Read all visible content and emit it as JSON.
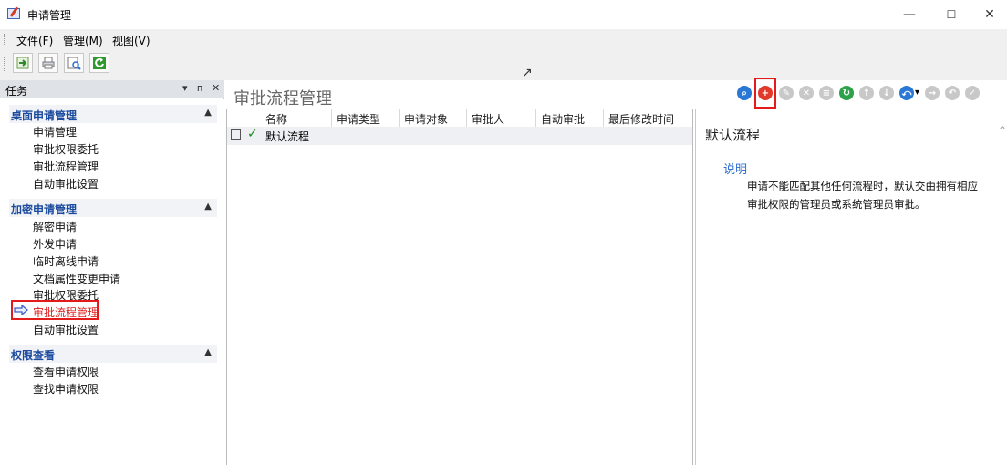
{
  "window": {
    "title": "申请管理",
    "minimize": "—",
    "maximize": "☐",
    "close": "✕"
  },
  "menu": {
    "items": [
      "文件(F)",
      "管理(M)",
      "视图(V)"
    ]
  },
  "tasks_panel": {
    "title": "任务",
    "controls": [
      "▾",
      "ᴨ",
      "✕"
    ],
    "groups": [
      {
        "title": "桌面申请管理",
        "items": [
          "申请管理",
          "审批权限委托",
          "审批流程管理",
          "自动审批设置"
        ]
      },
      {
        "title": "加密申请管理",
        "items": [
          "解密申请",
          "外发申请",
          "临时离线申请",
          "文档属性变更申请",
          "审批权限委托",
          "审批流程管理",
          "自动审批设置"
        ]
      },
      {
        "title": "权限查看",
        "items": [
          "查看申请权限",
          "查找申请权限"
        ]
      }
    ],
    "active_item": "审批流程管理"
  },
  "main": {
    "title": "审批流程管理",
    "columns": [
      "名称",
      "申请类型",
      "申请对象",
      "审批人",
      "自动审批",
      "最后修改时间"
    ],
    "rows": [
      {
        "checked": "☑",
        "status": "✓",
        "name": "默认流程"
      }
    ]
  },
  "detail": {
    "title": "默认流程",
    "section": "说明",
    "description": "申请不能匹配其他任何流程时，默认交由拥有相应审批权限的管理员或系统管理员审批。"
  },
  "colors": {
    "accent_blue": "#1b4a9e",
    "highlight_red": "#e31b1b",
    "ok_green": "#1a8a1a"
  }
}
